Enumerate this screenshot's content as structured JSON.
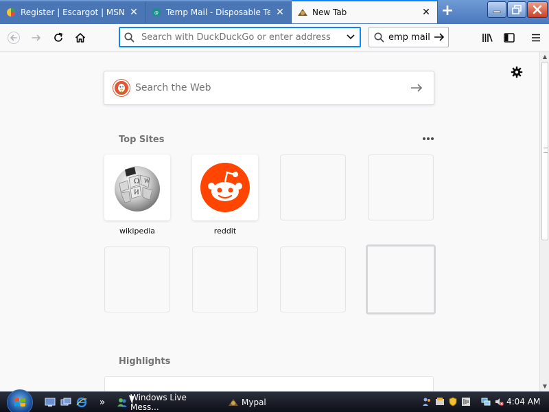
{
  "tabs": [
    {
      "title": "Register | Escargot | MSN Me",
      "icon": "escargot-icon",
      "active": false
    },
    {
      "title": "Temp Mail - Disposable Tem",
      "icon": "tempmail-icon",
      "active": false
    },
    {
      "title": "New Tab",
      "icon": "firefox-newtab-icon",
      "active": true
    }
  ],
  "tab_close_glyph": "✕",
  "new_tab_glyph": "+",
  "urlbar": {
    "placeholder": "Search with DuckDuckGo or enter address",
    "value": ""
  },
  "searchbar": {
    "value": "emp mail"
  },
  "websearch": {
    "placeholder": "Search the Web"
  },
  "top_sites": {
    "title": "Top Sites",
    "tiles": [
      {
        "label": "wikipedia",
        "icon": "wikipedia-globe-icon"
      },
      {
        "label": "reddit",
        "icon": "reddit-alien-icon"
      },
      {
        "label": "",
        "icon": ""
      },
      {
        "label": "",
        "icon": ""
      },
      {
        "label": "",
        "icon": ""
      },
      {
        "label": "",
        "icon": ""
      },
      {
        "label": "",
        "icon": ""
      },
      {
        "label": "",
        "icon": ""
      }
    ]
  },
  "highlights": {
    "title": "Highlights"
  },
  "taskbar": {
    "buttons": [
      {
        "label": "Windows Live Mess...",
        "icon": "messenger-icon"
      },
      {
        "label": "Mypal",
        "icon": "mypal-icon"
      }
    ],
    "overflow_glyph": "»",
    "clock": "4:04 AM"
  },
  "colors": {
    "accent": "#0a84ff",
    "reddit": "#ff4500",
    "duckduckgo": "#de5833",
    "titlebar": "#5e8ac7"
  }
}
